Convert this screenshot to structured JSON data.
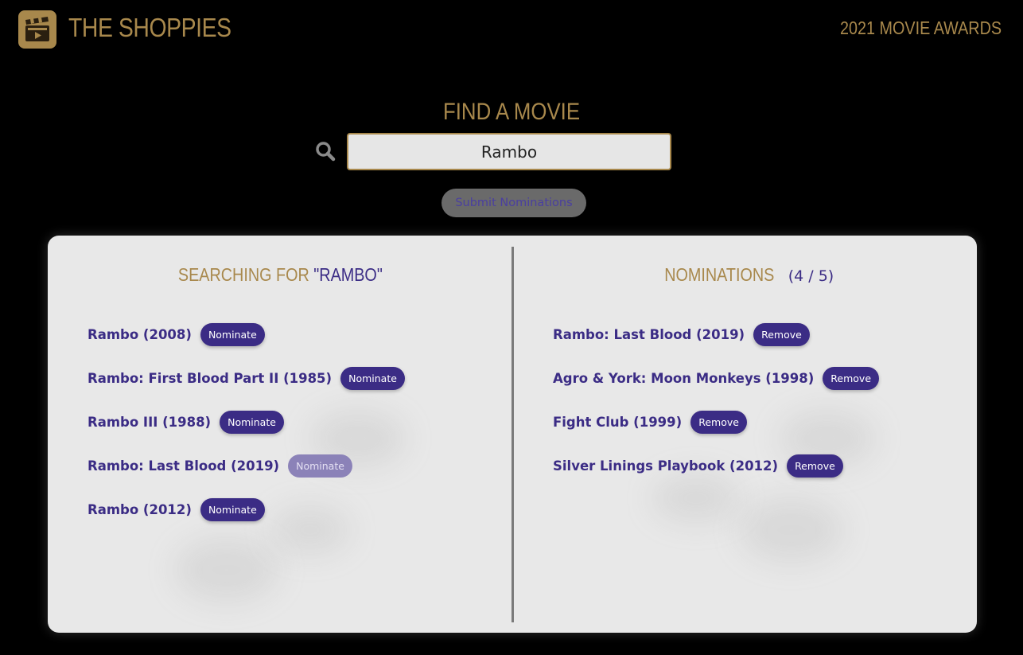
{
  "header": {
    "brand": "THE SHOPPIES",
    "awards": "2021 MOVIE AWARDS",
    "logo_icon": "clapperboard-icon"
  },
  "search": {
    "title": "FIND A MOVIE",
    "icon": "search-icon",
    "value": "Rambo",
    "submit_label": "Submit Nominations"
  },
  "results": {
    "heading_prefix": "SEARCHING FOR ",
    "heading_query": "\"RAMBO\"",
    "items": [
      {
        "title": "Rambo (2008)",
        "action": "Nominate",
        "disabled": false
      },
      {
        "title": "Rambo: First Blood Part II (1985)",
        "action": "Nominate",
        "disabled": false
      },
      {
        "title": "Rambo III (1988)",
        "action": "Nominate",
        "disabled": false
      },
      {
        "title": "Rambo: Last Blood (2019)",
        "action": "Nominate",
        "disabled": true
      },
      {
        "title": "Rambo (2012)",
        "action": "Nominate",
        "disabled": false
      }
    ]
  },
  "nominations": {
    "heading": "NOMINATIONS",
    "count": "(4 / 5)",
    "items": [
      {
        "title": "Rambo: Last Blood (2019)",
        "action": "Remove"
      },
      {
        "title": "Agro & York: Moon Monkeys (1998)",
        "action": "Remove"
      },
      {
        "title": "Fight Club (1999)",
        "action": "Remove"
      },
      {
        "title": "Silver Linings Playbook (2012)",
        "action": "Remove"
      }
    ]
  },
  "colors": {
    "gold": "#a8884c",
    "purple": "#3b2c85",
    "panel": "#e8e8e8"
  }
}
